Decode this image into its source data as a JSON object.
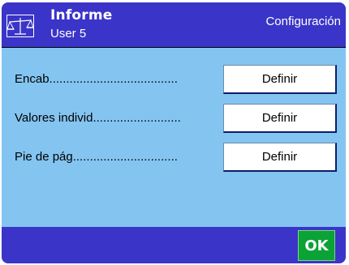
{
  "header": {
    "title": "Informe",
    "user": "User 5",
    "right_label": "Configuración"
  },
  "rows": [
    {
      "label": "Encab......................................",
      "button": "Definir"
    },
    {
      "label": "Valores individ..........................",
      "button": "Definir"
    },
    {
      "label": "Pie de pág...............................",
      "button": "Definir"
    }
  ],
  "footer": {
    "ok_label": "OK"
  },
  "colors": {
    "header_bg": "#3a35c8",
    "content_bg": "#84c4f0",
    "ok_bg": "#0ba236"
  },
  "icons": [
    "scale-icon"
  ]
}
